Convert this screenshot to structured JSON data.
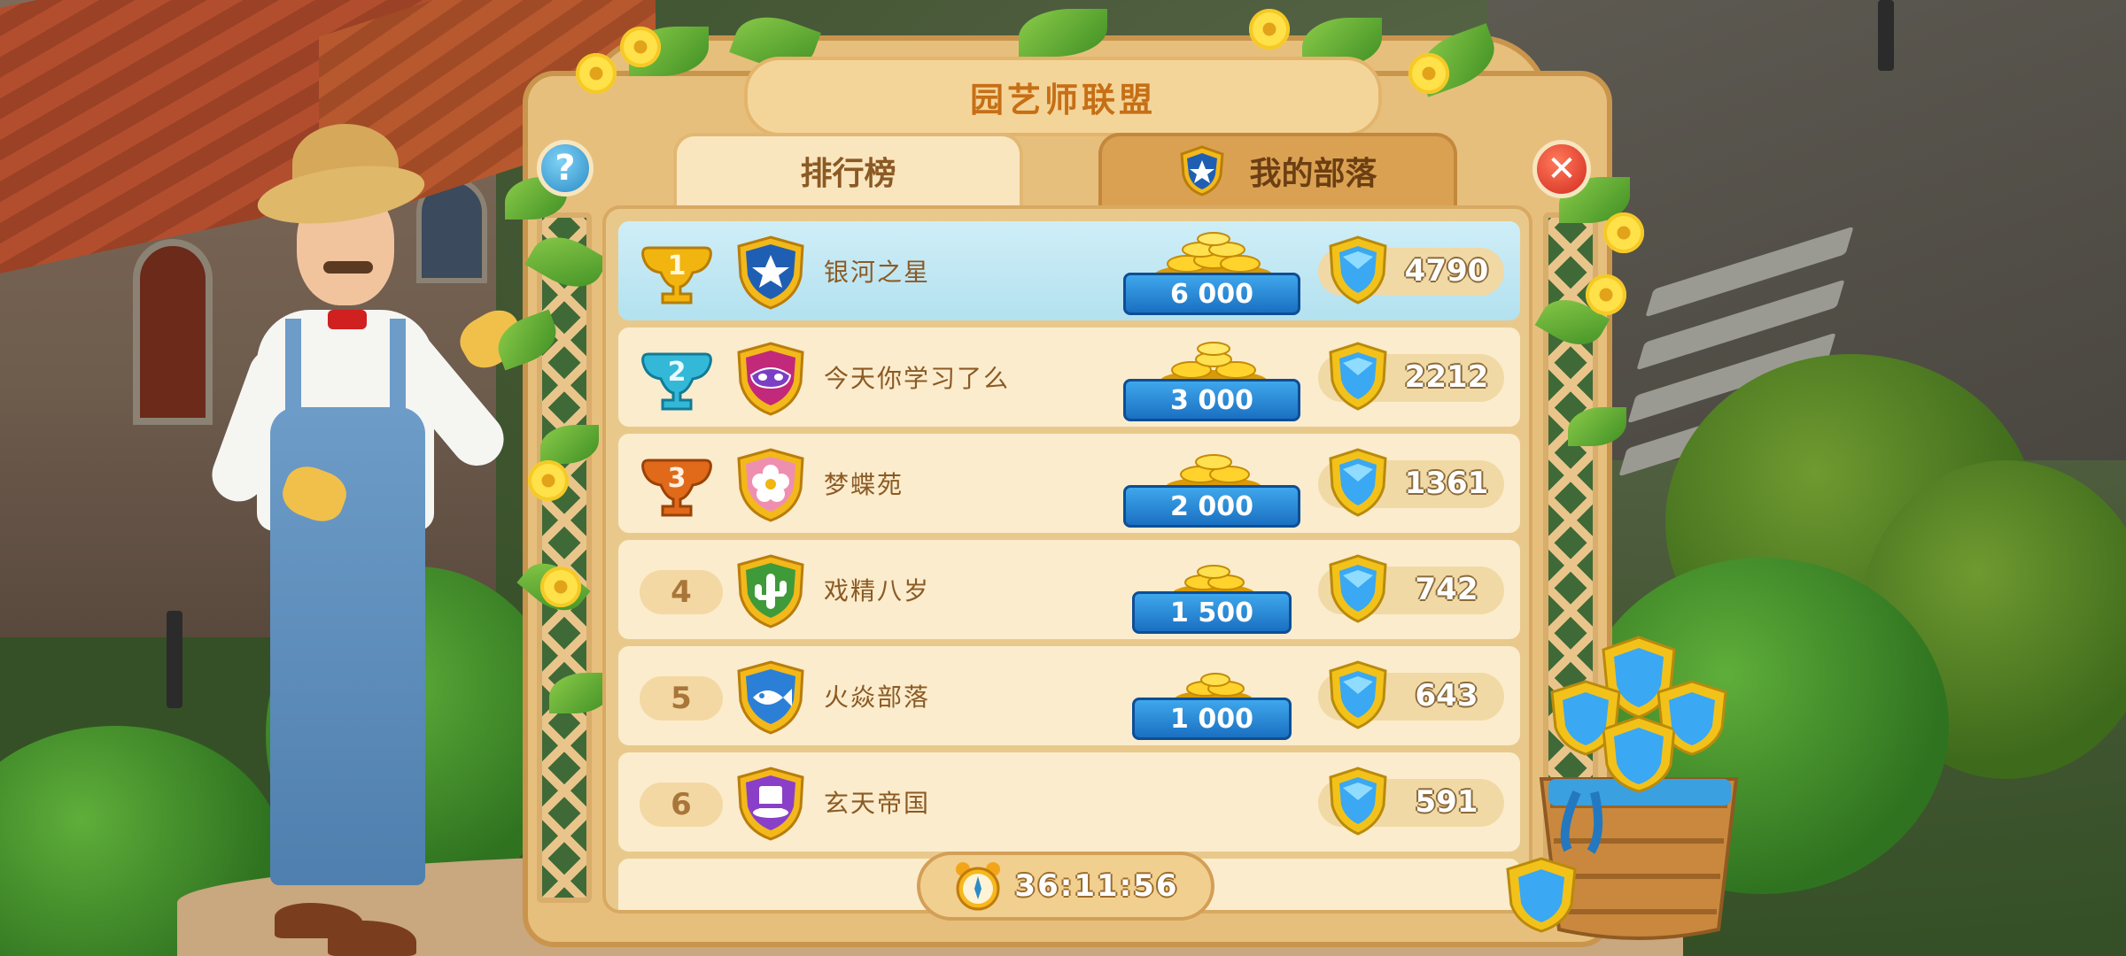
{
  "title": "园艺师联盟",
  "tabs": [
    {
      "label": "排行榜",
      "active": true
    },
    {
      "label": "我的部落",
      "active": false
    }
  ],
  "colors": {
    "title": "#c66f16",
    "highlight_row": "#cfeef7",
    "ribbon": "#1a70c2",
    "gold_trophy": "#f2b40f",
    "silver_trophy": "#33b8d8",
    "bronze_trophy": "#e06a1a"
  },
  "leaderboard": [
    {
      "rank": "1",
      "name": "银河之星",
      "reward": "6 000",
      "score": "4790",
      "badge": "star-badge-icon"
    },
    {
      "rank": "2",
      "name": "今天你学习了么",
      "reward": "3 000",
      "score": "2212",
      "badge": "mask-badge-icon"
    },
    {
      "rank": "3",
      "name": "梦蝶苑",
      "reward": "2 000",
      "score": "1361",
      "badge": "flower-badge-icon"
    },
    {
      "rank": "4",
      "name": "戏精八岁",
      "reward": "1 500",
      "score": "742",
      "badge": "cactus-badge-icon"
    },
    {
      "rank": "5",
      "name": "火焱部落",
      "reward": "1 000",
      "score": "643",
      "badge": "fish-badge-icon"
    },
    {
      "rank": "6",
      "name": "玄天帝国",
      "reward": "",
      "score": "591",
      "badge": "top-hat-badge-icon"
    }
  ],
  "timer": "36:11:56"
}
